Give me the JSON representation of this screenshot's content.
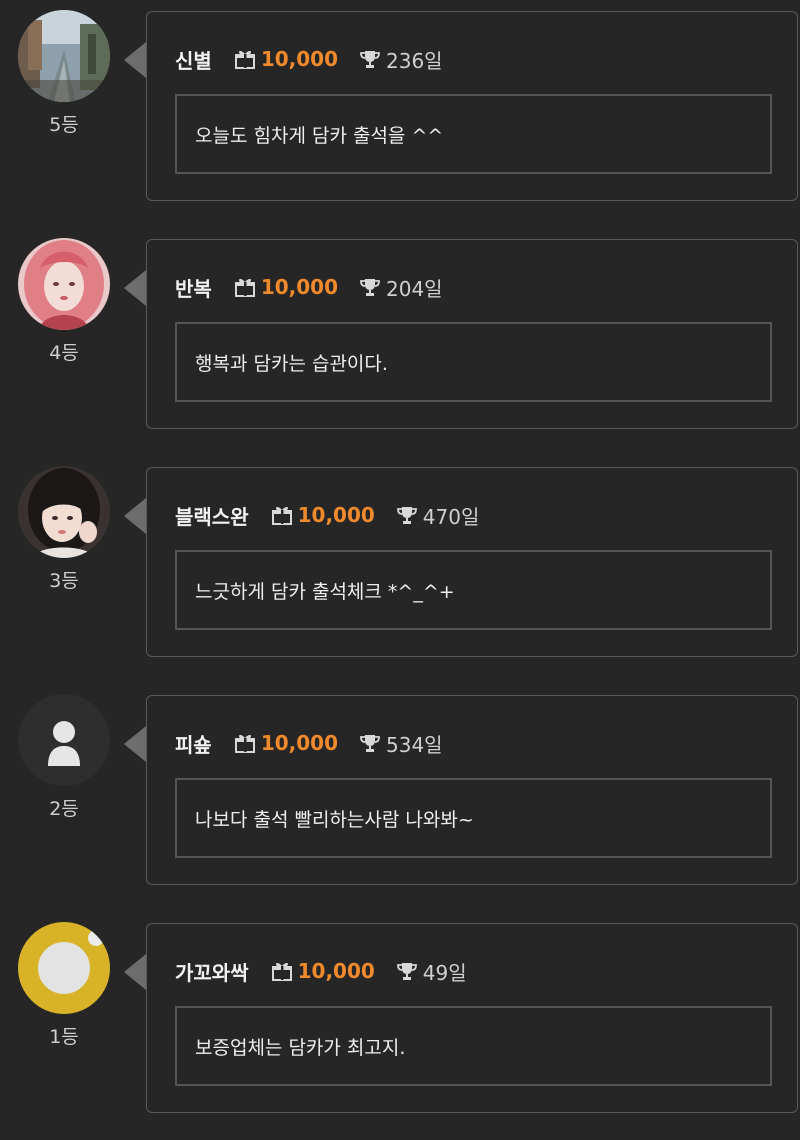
{
  "colors": {
    "background": "#262626",
    "points": "#f08a2c",
    "border": "#5a5a5a"
  },
  "entries": [
    {
      "rank": "5등",
      "nickname": "신별",
      "points": "10,000",
      "days": "236일",
      "message": "오늘도 힘차게 담카 출석을 ^^",
      "avatar": "city-canal-photo"
    },
    {
      "rank": "4등",
      "nickname": "반복",
      "points": "10,000",
      "days": "204일",
      "message": "행복과 담카는 습관이다.",
      "avatar": "pink-hair-portrait"
    },
    {
      "rank": "3등",
      "nickname": "블랙스완",
      "points": "10,000",
      "days": "470일",
      "message": "느긋하게 담카 출석체크 *^_^+",
      "avatar": "girl-portrait"
    },
    {
      "rank": "2등",
      "nickname": "피숖",
      "points": "10,000",
      "days": "534일",
      "message": "나보다 출석 빨리하는사람 나와봐~",
      "avatar": "default-user-icon"
    },
    {
      "rank": "1등",
      "nickname": "가꼬와싹",
      "points": "10,000",
      "days": "49일",
      "message": "보증업체는 담카가 최고지.",
      "avatar": "yellow-circle-avatar"
    }
  ]
}
